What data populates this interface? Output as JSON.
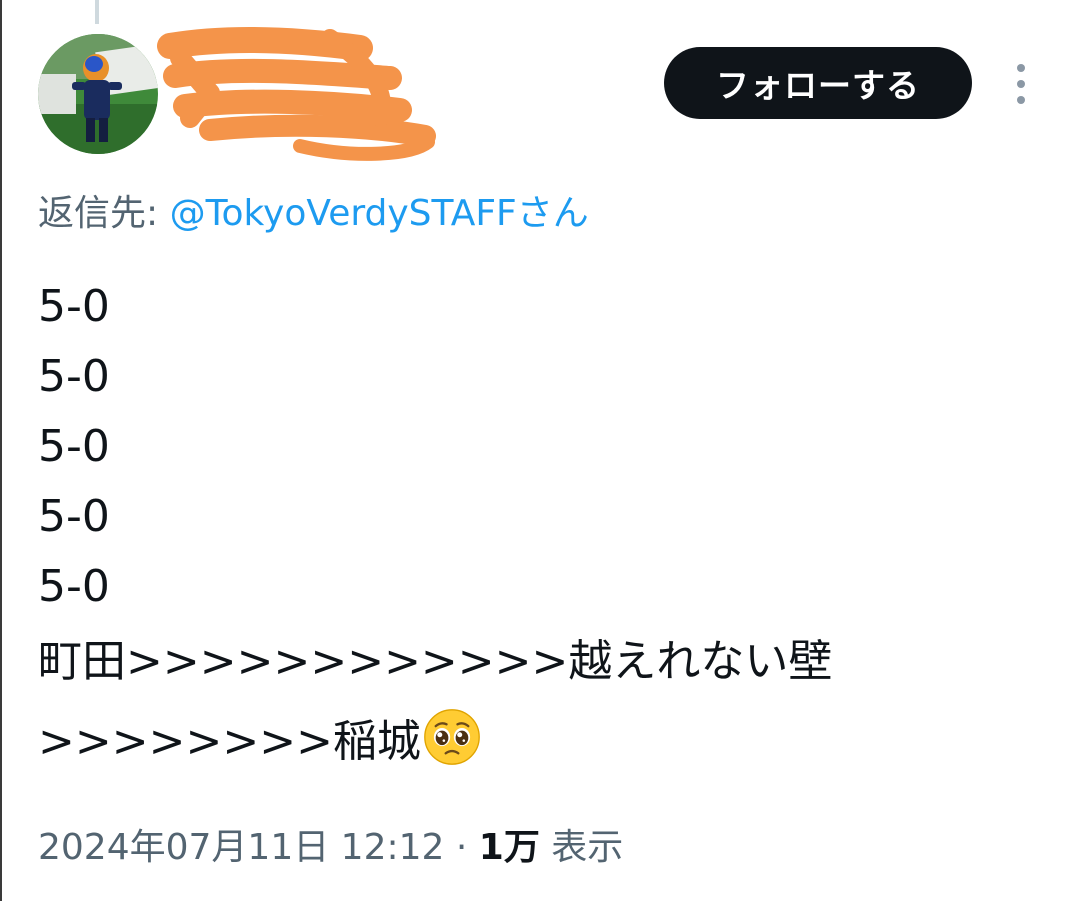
{
  "tweet": {
    "follow_label": "フォローする",
    "reply_prefix": "返信先: ",
    "reply_handle": "@TokyoVerdySTAFFさん",
    "lines": [
      "5-0",
      "5-0",
      "5-0",
      "5-0",
      "5-0",
      "町田>>>>>>>>>>>>越えれない壁",
      ">>>>>>>>稲城"
    ],
    "emoji": "pleading-face",
    "timestamp": "2024年07月11日 12:12",
    "separator": " · ",
    "views_count": "1万",
    "views_label": "表示"
  },
  "icons": {
    "more": "more-vertical-icon",
    "avatar": "user-avatar"
  },
  "colors": {
    "text_primary": "#0f1419",
    "text_secondary": "#536471",
    "link": "#1d9bf0",
    "redaction": "#f4944a",
    "button_bg": "#0f1419"
  }
}
